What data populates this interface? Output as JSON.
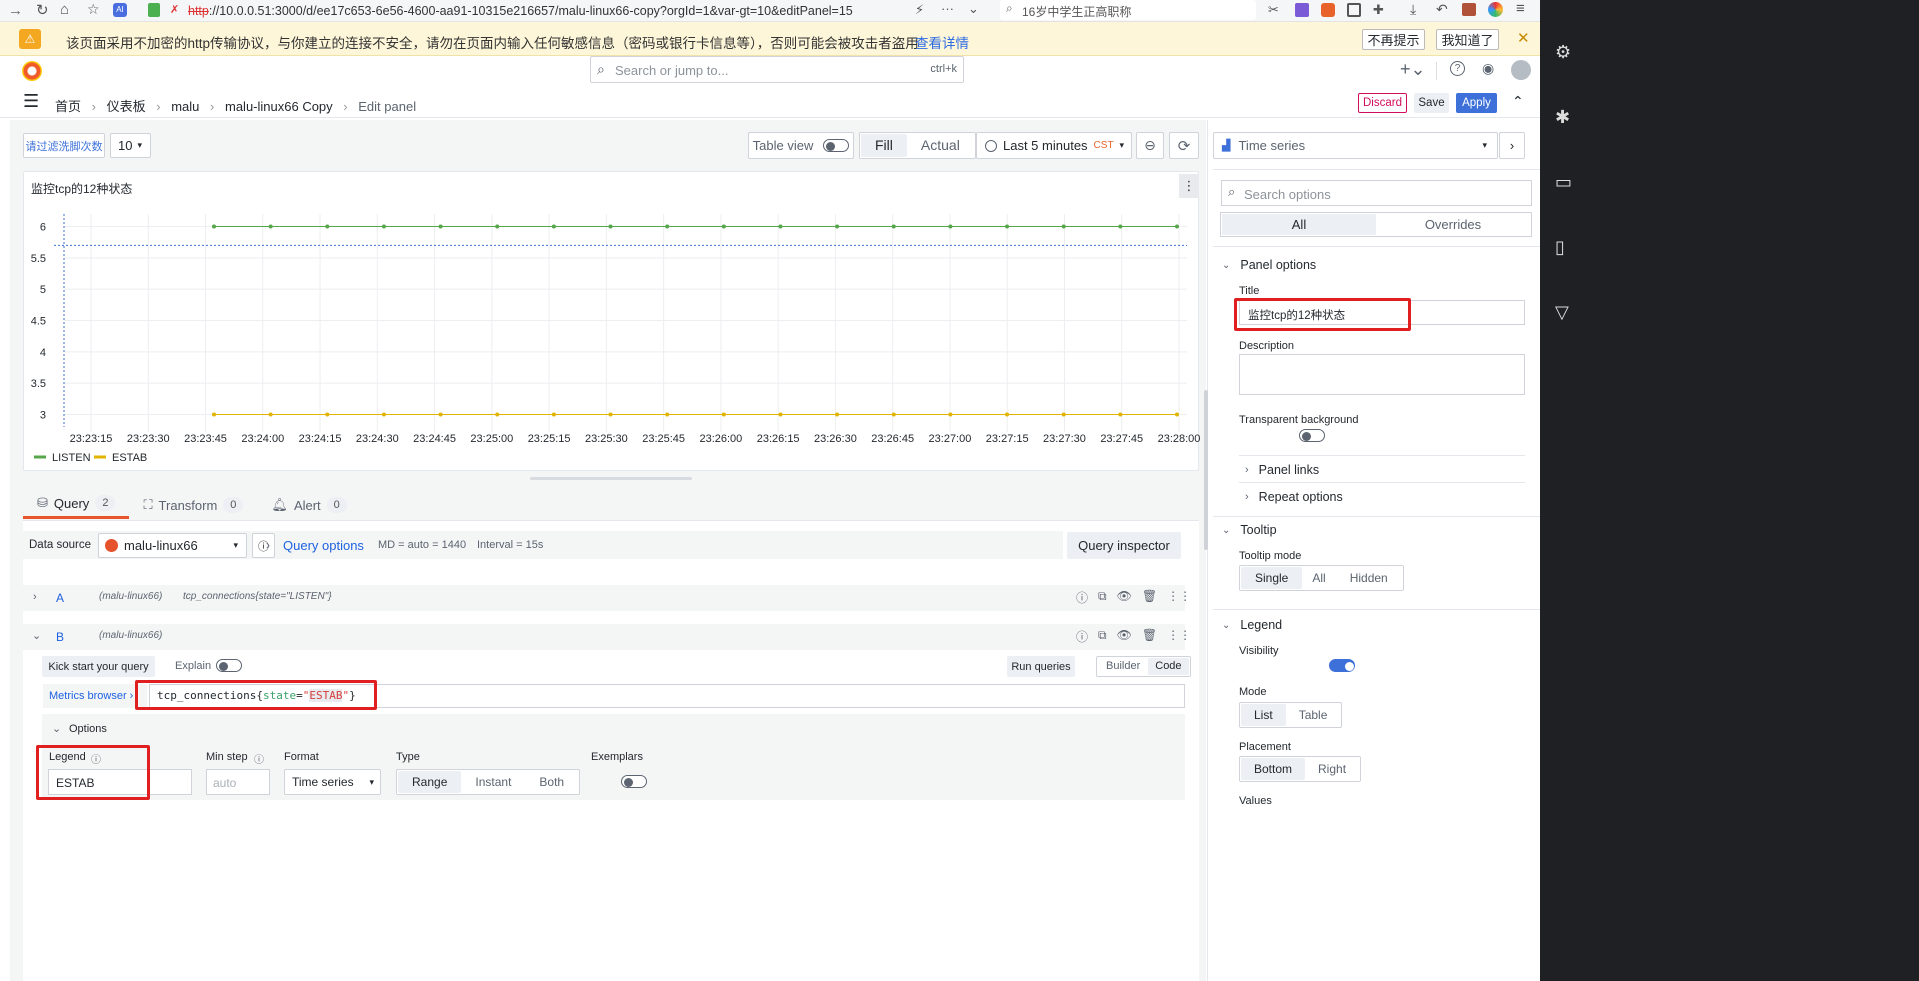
{
  "browser": {
    "url_scheme": "http",
    "url_rest": "://10.0.0.51:3000/d/ee17c653-6e56-4600-aa91-10315e216657/malu-linux66-copy?orgId=1&var-gt=10&editPanel=15",
    "search_placeholder": "16岁中学生正高职称",
    "warning": "该页面采用不加密的http传输协议，与你建立的连接不安全，请勿在页面内输入任何敏感信息（密码或银行卡信息等），否则可能会被攻击者盗用",
    "warning_link": "查看详情",
    "dont_remind": "不再提示",
    "got_it": "我知道了"
  },
  "topnav": {
    "search_placeholder": "Search or jump to...",
    "shortcut": "ctrl+k"
  },
  "breadcrumb": [
    "首页",
    "仪表板",
    "malu",
    "malu-linux66 Copy",
    "Edit panel"
  ],
  "actions": {
    "discard": "Discard",
    "save": "Save",
    "apply": "Apply"
  },
  "toolbar": {
    "variable_label": "请过滤洗脚次数",
    "variable_value": "10",
    "table_view": "Table view",
    "fill": "Fill",
    "actual": "Actual",
    "time_range": "Last 5 minutes",
    "timezone": "CST",
    "visualization": "Time series"
  },
  "panel": {
    "title": "监控tcp的12种状态"
  },
  "chart_data": {
    "type": "line",
    "x": [
      "23:23:15",
      "23:23:30",
      "23:23:45",
      "23:24:00",
      "23:24:15",
      "23:24:30",
      "23:24:45",
      "23:25:00",
      "23:25:15",
      "23:25:30",
      "23:25:45",
      "23:26:00",
      "23:26:15",
      "23:26:30",
      "23:26:45",
      "23:27:00",
      "23:27:15",
      "23:27:30",
      "23:27:45",
      "23:28:00"
    ],
    "yticks": [
      "6",
      "5.5",
      "5",
      "4.5",
      "4",
      "3.5",
      "3"
    ],
    "ylim": [
      2.8,
      6.2
    ],
    "series": [
      {
        "name": "LISTEN",
        "color": "#56a64b",
        "values": [
          null,
          null,
          6,
          6,
          6,
          6,
          6,
          6,
          6,
          6,
          6,
          6,
          6,
          6,
          6,
          6,
          6,
          6,
          6,
          6,
          6,
          6
        ]
      },
      {
        "name": "ESTAB",
        "color": "#e0b400",
        "values": [
          null,
          null,
          3,
          3,
          3,
          3,
          3,
          3,
          3,
          3,
          3,
          3,
          3,
          3,
          3,
          3,
          3,
          3,
          3,
          3,
          3,
          3
        ]
      }
    ],
    "grid": true,
    "legend": "bottom-left"
  },
  "query_tabs": [
    {
      "label": "Query",
      "count": "2"
    },
    {
      "label": "Transform",
      "count": "0"
    },
    {
      "label": "Alert",
      "count": "0"
    }
  ],
  "datasource": {
    "label": "Data source",
    "name": "malu-linux66",
    "query_options": "Query options",
    "md": "MD = auto = 1440",
    "interval": "Interval = 15s",
    "inspector": "Query inspector"
  },
  "queries": [
    {
      "ref": "A",
      "ds": "(malu-linux66)",
      "expr": "tcp_connections{state=\"LISTEN\"}"
    },
    {
      "ref": "B",
      "ds": "(malu-linux66)"
    }
  ],
  "editor": {
    "kick_start": "Kick start your query",
    "explain": "Explain",
    "run": "Run queries",
    "builder": "Builder",
    "code": "Code",
    "metrics_browser": "Metrics browser",
    "expr_metric": "tcp_connections",
    "expr_key": "state",
    "expr_val": "ESTAB",
    "options": "Options",
    "legend_label": "Legend",
    "legend_value": "ESTAB",
    "minstep_label": "Min step",
    "minstep_placeholder": "auto",
    "format_label": "Format",
    "format_value": "Time series",
    "type_label": "Type",
    "type_opts": [
      "Range",
      "Instant",
      "Both"
    ],
    "exemplars_label": "Exemplars"
  },
  "options_pane": {
    "search_placeholder": "Search options",
    "tab_all": "All",
    "tab_overrides": "Overrides",
    "panel_options": "Panel options",
    "title_label": "Title",
    "title_value": "监控tcp的12种状态",
    "description_label": "Description",
    "transparent_label": "Transparent background",
    "panel_links": "Panel links",
    "repeat_options": "Repeat options",
    "tooltip": "Tooltip",
    "tooltip_mode": "Tooltip mode",
    "tooltip_opts": [
      "Single",
      "All",
      "Hidden"
    ],
    "legend": "Legend",
    "visibility": "Visibility",
    "mode_label": "Mode",
    "mode_opts": [
      "List",
      "Table"
    ],
    "placement_label": "Placement",
    "placement_opts": [
      "Bottom",
      "Right"
    ],
    "values_label": "Values"
  }
}
